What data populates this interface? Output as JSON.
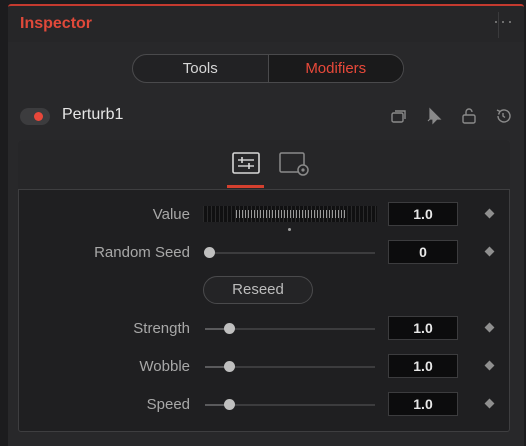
{
  "header": {
    "title": "Inspector",
    "more_icon": "ellipsis-icon"
  },
  "mode_tabs": [
    {
      "label": "Tools",
      "active": false
    },
    {
      "label": "Modifiers",
      "active": true
    }
  ],
  "tool": {
    "name": "Perturb1",
    "enabled": true,
    "accent": "#e8473a"
  },
  "tool_icons": [
    "versions-icon",
    "pin-icon",
    "lock-icon",
    "reset-icon"
  ],
  "sub_tabs": [
    "controls-tab-icon",
    "settings-tab-icon"
  ],
  "params": {
    "value": {
      "label": "Value",
      "value": "1.0"
    },
    "random_seed": {
      "label": "Random Seed",
      "value": "0",
      "slider": 0.0
    },
    "reseed": {
      "label": "Reseed"
    },
    "strength": {
      "label": "Strength",
      "value": "1.0",
      "slider": 0.12
    },
    "wobble": {
      "label": "Wobble",
      "value": "1.0",
      "slider": 0.12
    },
    "speed": {
      "label": "Speed",
      "value": "1.0",
      "slider": 0.12
    }
  },
  "colors": {
    "accent": "#e0493a",
    "background": "#1c1c1e"
  }
}
